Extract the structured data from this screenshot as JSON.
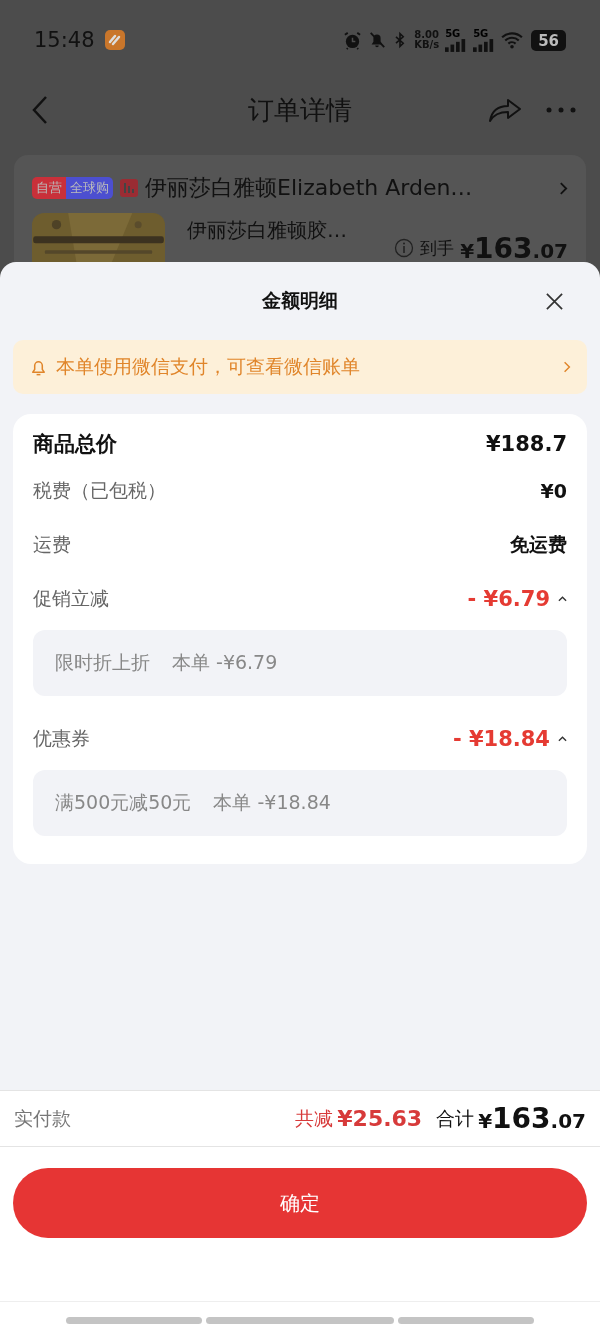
{
  "status_bar": {
    "time": "15:48",
    "network_speed": "8.00",
    "network_speed_unit": "KB/s",
    "signal_1": "5G",
    "signal_2": "5G",
    "battery": "56"
  },
  "header": {
    "title": "订单详情"
  },
  "order_card": {
    "badges": [
      {
        "text": "自营",
        "color": "#c9303a"
      },
      {
        "text": "全球购",
        "color": "#4c4fd0"
      }
    ],
    "shop_name": "伊丽莎白雅顿Elizabeth Arden…",
    "product_name": "伊丽莎白雅顿胶…",
    "price_label": "到手",
    "price_currency": "¥",
    "price_integer": "163",
    "price_decimal": ".07"
  },
  "sheet": {
    "title": "金额明细",
    "notice": "本单使用微信支付，可查看微信账单",
    "rows": [
      {
        "kind": "total",
        "label": "商品总价",
        "value": "¥188.7"
      },
      {
        "kind": "plain",
        "label": "税费（已包税）",
        "value": "¥0"
      },
      {
        "kind": "plain",
        "label": "运费",
        "value": "免运费"
      },
      {
        "kind": "discount",
        "label": "促销立减",
        "value": "- ¥6.79",
        "expanded": true,
        "details": [
          {
            "name": "限时折上折",
            "amount": "本单 -¥6.79"
          }
        ]
      },
      {
        "kind": "discount",
        "label": "优惠券",
        "value": "- ¥18.84",
        "expanded": true,
        "details": [
          {
            "name": "满500元减50元",
            "amount": "本单 -¥18.84"
          }
        ]
      }
    ]
  },
  "footer": {
    "label": "实付款",
    "saved_label": "共减",
    "saved_amount": "¥25.63",
    "total_label": "合计",
    "total_currency": "¥",
    "total_integer": "163",
    "total_decimal": ".07"
  },
  "confirm_button": "确定"
}
